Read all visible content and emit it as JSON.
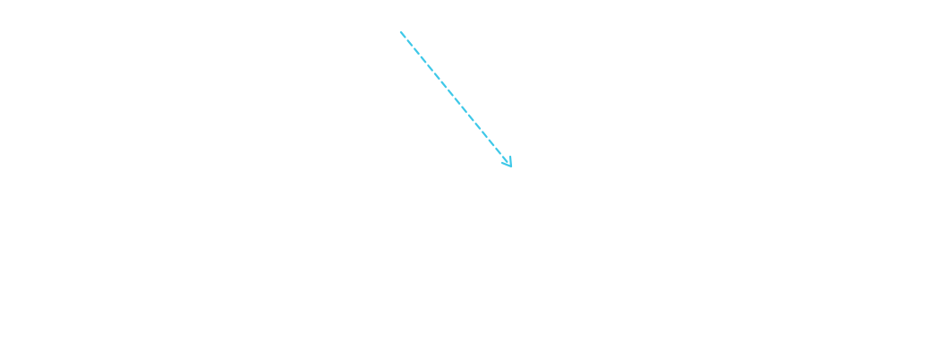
{
  "canvas": {
    "background": "#ffffff"
  },
  "connector": {
    "line_style": "dashed",
    "color": "#3ec8e8",
    "arrowhead": "open-chevron",
    "direction": "down-right"
  }
}
